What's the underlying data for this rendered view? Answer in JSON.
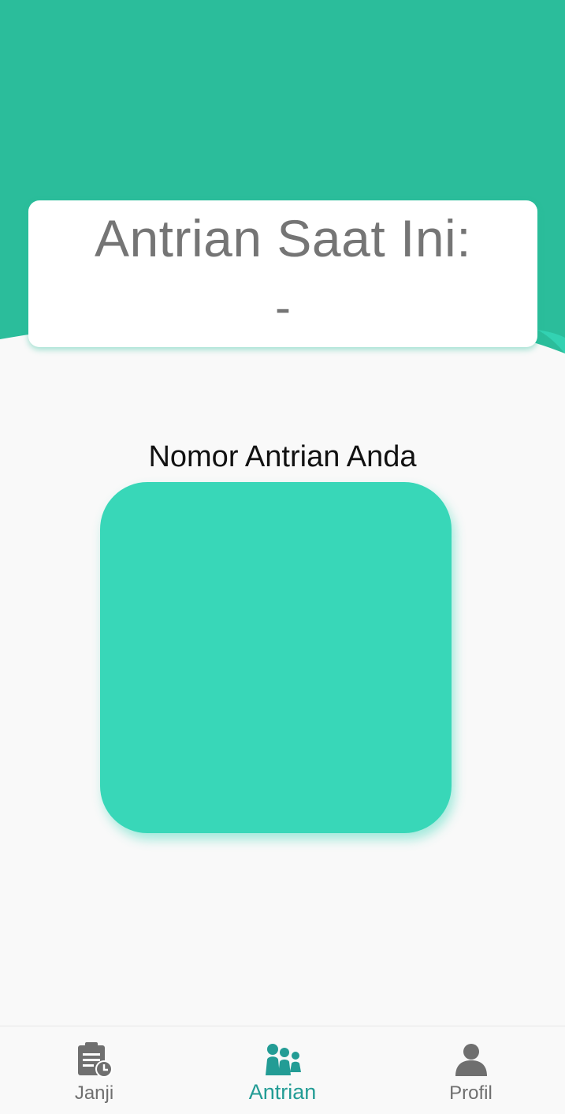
{
  "colors": {
    "header": "#2bbd9b",
    "card": "#ffffff",
    "number_box": "#38d7b8",
    "active_nav": "#239c95",
    "inactive_nav": "#6f6f6f"
  },
  "current_queue": {
    "title": "Antrian Saat Ini:",
    "value": "-"
  },
  "my_queue": {
    "label": "Nomor Antrian Anda",
    "value": ""
  },
  "bottom_nav": {
    "items": [
      {
        "label": "Janji",
        "icon": "clipboard-clock-icon",
        "active": false
      },
      {
        "label": "Antrian",
        "icon": "group-icon",
        "active": true
      },
      {
        "label": "Profil",
        "icon": "person-icon",
        "active": false
      }
    ]
  }
}
